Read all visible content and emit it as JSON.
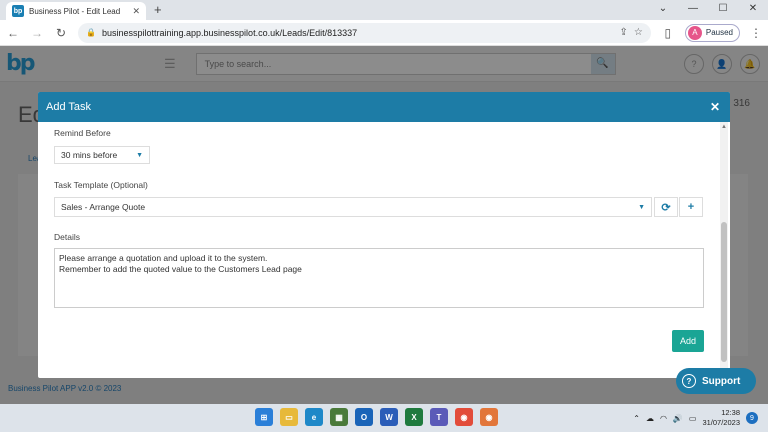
{
  "browser": {
    "tab_title": "Business Pilot - Edit Lead",
    "tab_favicon": "bp",
    "url": "businesspilottraining.app.businesspilot.co.uk/Leads/Edit/813337",
    "profile_initial": "A",
    "profile_status": "Paused"
  },
  "app": {
    "logo_text": "bp",
    "search_placeholder": "Type to search...",
    "page_title_partial": "Ed",
    "lead_number_partial": "316",
    "tab_partial": "Lea",
    "footer": "Business Pilot APP v2.0 © 2023"
  },
  "modal": {
    "title": "Add Task",
    "remind_label": "Remind Before",
    "remind_value": "30 mins before",
    "template_label": "Task Template (Optional)",
    "template_value": "Sales - Arrange Quote",
    "details_label": "Details",
    "details_line1": "Please arrange a quotation and upload it to the system.",
    "details_line2": "Remember to add the quoted value to the Customers Lead page",
    "add_label": "Add"
  },
  "support": {
    "label": "Support"
  },
  "taskbar": {
    "time": "12:38",
    "date": "31/07/2023",
    "notifications": "9"
  },
  "colors": {
    "accent": "#1d7ca6",
    "add_button": "#1aa595"
  }
}
